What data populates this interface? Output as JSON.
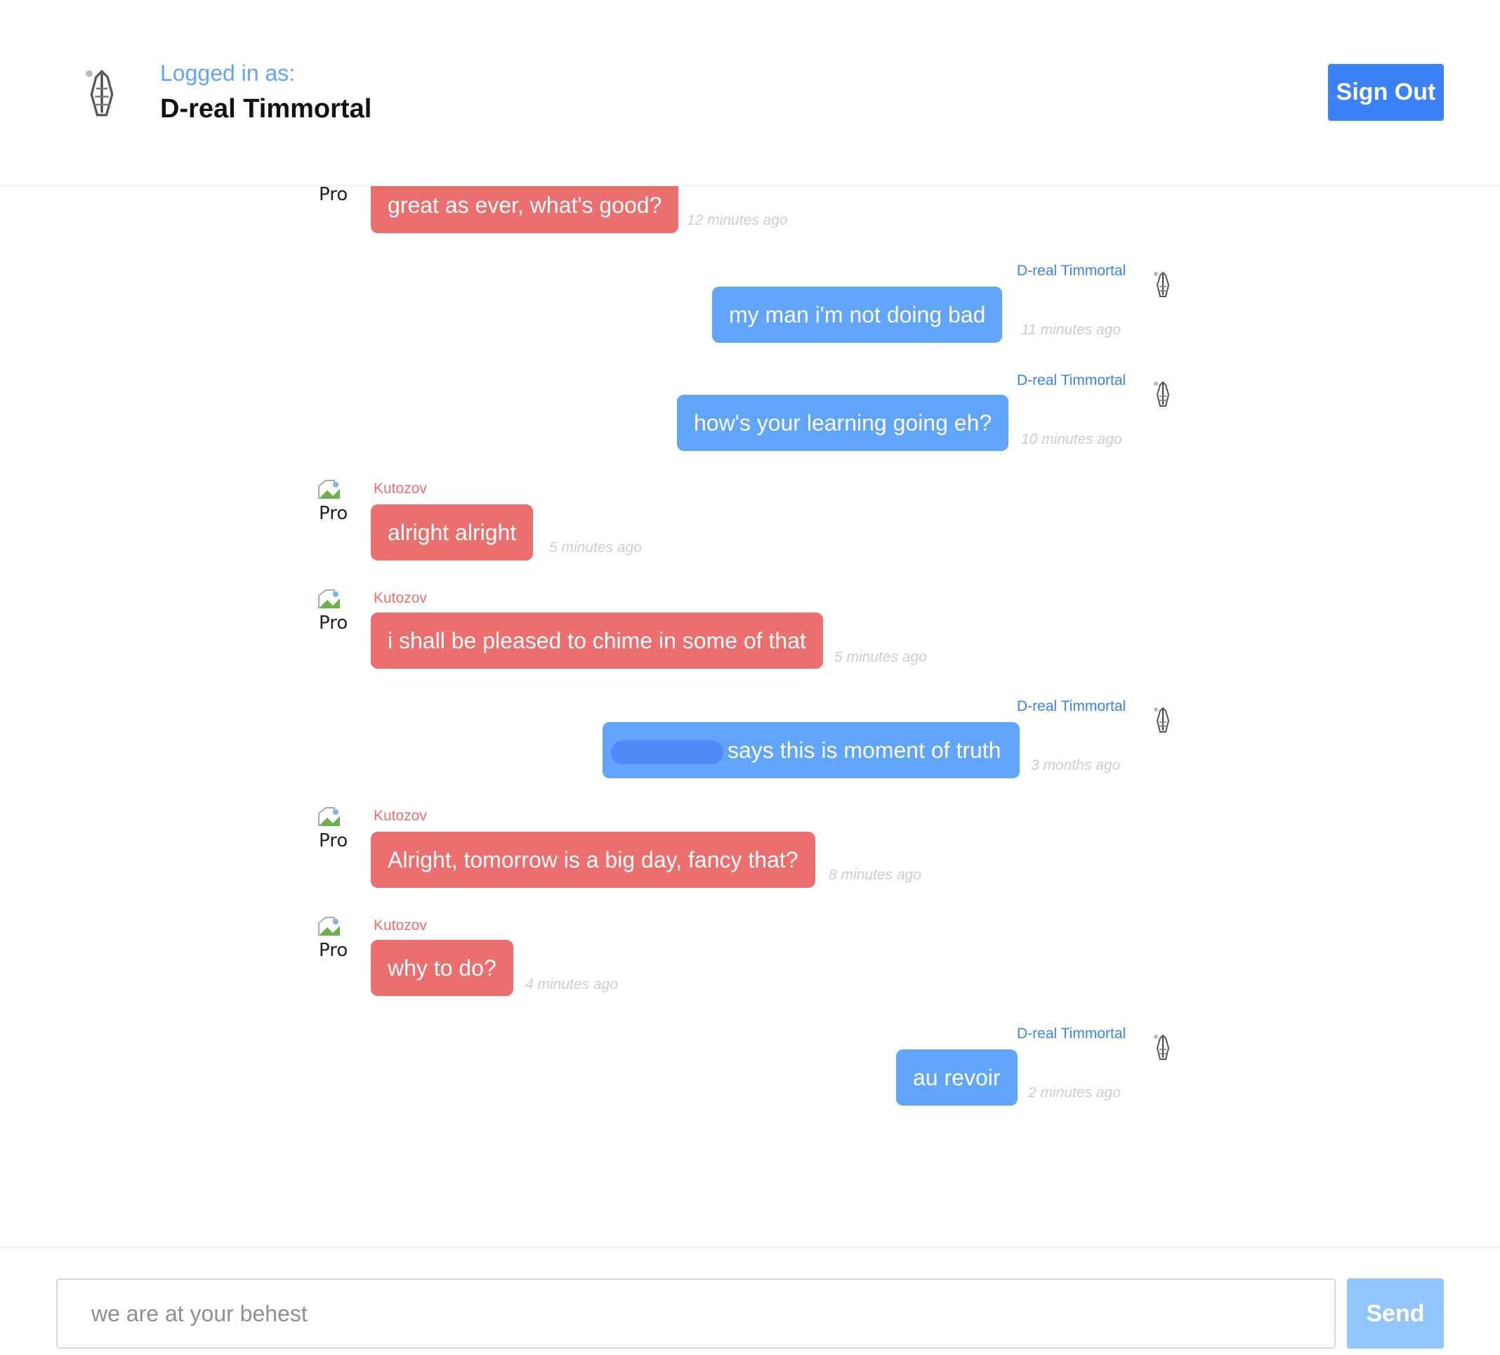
{
  "header": {
    "logged_in_label": "Logged in as:",
    "username": "D-real Timmortal",
    "sign_out_label": "Sign Out"
  },
  "messages": [
    {
      "side": "them",
      "sender": "",
      "text": "great as ever, what's good?",
      "time": "12 minutes ago",
      "avatar_alt": "Pro"
    },
    {
      "side": "me",
      "sender": "D-real Timmortal",
      "text": "my man i'm not doing bad",
      "time": "11 minutes ago"
    },
    {
      "side": "me",
      "sender": "D-real Timmortal",
      "text": "how's your learning going eh?",
      "time": "10 minutes ago"
    },
    {
      "side": "them",
      "sender": "Kutozov",
      "text": "alright alright",
      "time": "5 minutes ago",
      "avatar_alt": "Pro"
    },
    {
      "side": "them",
      "sender": "Kutozov",
      "text": "i shall be pleased to chime in some of that",
      "time": "5 minutes ago",
      "avatar_alt": "Pro"
    },
    {
      "side": "me",
      "sender": "D-real Timmortal",
      "text": "says this is moment of truth",
      "time": "3 months ago"
    },
    {
      "side": "them",
      "sender": "Kutozov",
      "text": "Alright, tomorrow is a big day, fancy that?",
      "time": "8 minutes ago",
      "avatar_alt": "Pro"
    },
    {
      "side": "them",
      "sender": "Kutozov",
      "text": "why to do?",
      "time": "4 minutes ago",
      "avatar_alt": "Pro"
    },
    {
      "side": "me",
      "sender": "D-real Timmortal",
      "text": "au revoir",
      "time": "2 minutes ago"
    }
  ],
  "composer": {
    "placeholder": "we are at your behest",
    "send_label": "Send"
  },
  "colors": {
    "accent": "#3b82f6",
    "my_bubble": "#60a5fa",
    "their_bubble": "#ec6f6f",
    "send_disabled": "#93c5fd"
  },
  "icons": {
    "user_avatar": "praying-hands-icon",
    "contact_avatar": "broken-image-icon"
  }
}
